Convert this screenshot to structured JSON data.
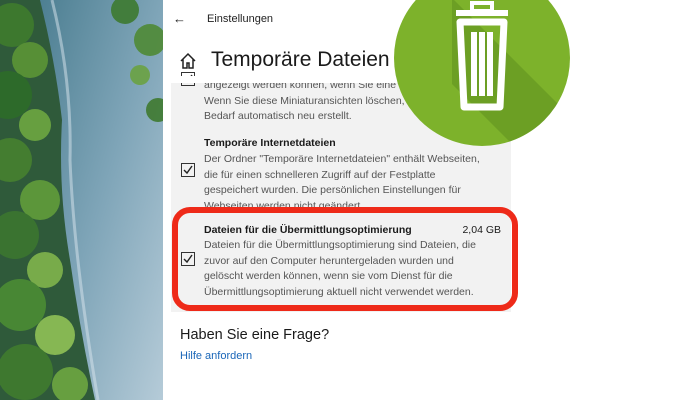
{
  "window": {
    "app_title": "Einstellungen",
    "page_title": "Temporäre Dateien"
  },
  "items": [
    {
      "name": "",
      "description_lines": [
        "angezeigt werden können, wenn Sie eine",
        "Wenn Sie diese Miniaturansichten löschen,",
        "Bedarf automatisch neu erstellt."
      ],
      "checked": true
    },
    {
      "name": "Temporäre Internetdateien",
      "size": "",
      "description_lines": [
        "Der Ordner \"Temporäre Internetdateien\" enthält Webseiten,",
        "die für einen schnelleren Zugriff auf der Festplatte",
        "gespeichert wurden. Die persönlichen Einstellungen für",
        "Webseiten werden nicht geändert."
      ],
      "checked": true
    },
    {
      "name": "Dateien für die Übermittlungsoptimierung",
      "size": "2,04 GB",
      "description_lines": [
        "Dateien für die Übermittlungsoptimierung sind Dateien, die",
        "zuvor auf den Computer heruntergeladen wurden und",
        "gelöscht werden können, wenn sie vom Dienst für die",
        "Übermittlungsoptimierung aktuell nicht verwendet werden."
      ],
      "checked": true,
      "highlighted": true
    }
  ],
  "faq": {
    "title": "Haben Sie eine Frage?",
    "help_link": "Hilfe anfordern"
  },
  "colors": {
    "accent_link": "#1a66b8",
    "highlight": "#ee2a19",
    "badge_green": "#7db22b"
  }
}
